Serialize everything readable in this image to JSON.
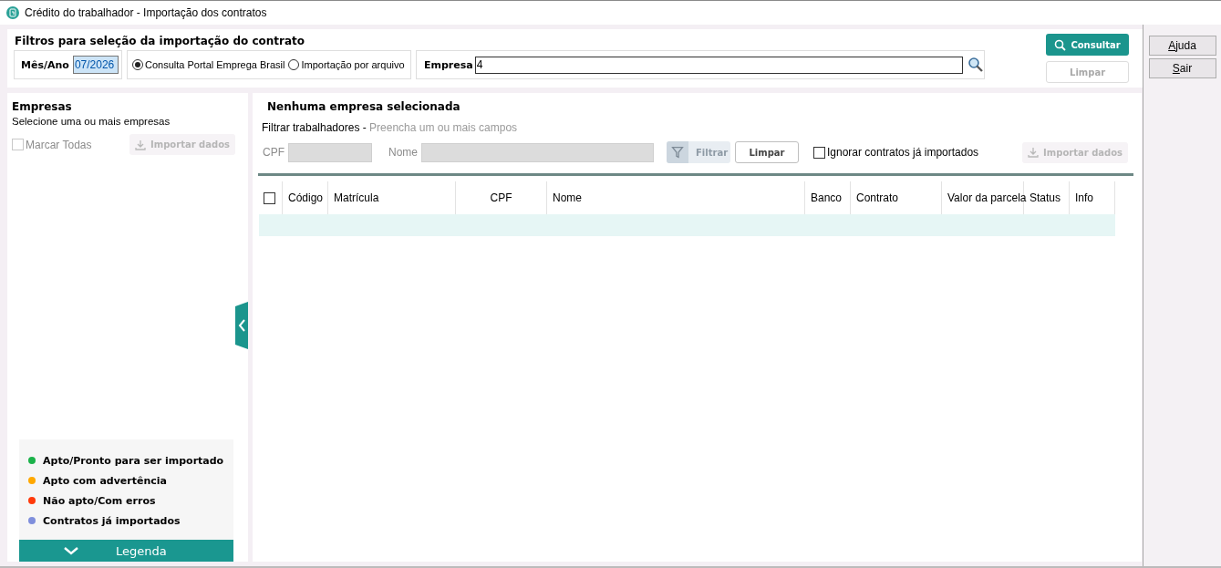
{
  "window": {
    "title": "Crédito do trabalhador - Importação dos contratos"
  },
  "filters": {
    "title": "Filtros para seleção da importação do contrato",
    "month_year": {
      "label": "Mês/Ano",
      "value": "07/2026"
    },
    "source_options": [
      {
        "label": "Consulta Portal Emprega Brasil",
        "selected": true
      },
      {
        "label": "Importação por arquivo",
        "selected": false
      }
    ],
    "company": {
      "label": "Empresa",
      "value": "4"
    },
    "buttons": [
      {
        "kind": "search",
        "label": "Consultar"
      },
      {
        "kind": "plain",
        "label": "Limpar",
        "disabled": true
      }
    ]
  },
  "side_buttons": [
    {
      "label": "Ajuda"
    },
    {
      "label": "Sair"
    }
  ],
  "companies_panel": {
    "title": "Empresas",
    "subtitle": "Selecione uma ou mais empresas",
    "select_all": {
      "label": "Marcar Todas",
      "checked": false,
      "disabled": true
    },
    "import_button": {
      "label": "Importar dados",
      "disabled": true
    },
    "legend": [
      {
        "label": "Apto/Pronto para ser importado",
        "color": "#1bb24a"
      },
      {
        "label": "Apto com advertência",
        "color": "#ffa800"
      },
      {
        "label": "Não apto/Com erros",
        "color": "#ff3a0a"
      },
      {
        "label": "Contratos já importados",
        "color": "#7f8fdc"
      }
    ],
    "legend_toggle": "Legenda"
  },
  "workers_panel": {
    "title": "Nenhuma empresa selecionada",
    "filter_label": "Filtrar trabalhadores - ",
    "filter_hint": "Preencha um ou mais campos",
    "cpf": {
      "label": "CPF",
      "disabled": true
    },
    "name": {
      "label": "Nome",
      "disabled": true
    },
    "filter_button": {
      "label": "Filtrar",
      "disabled": true
    },
    "clear_button": {
      "label": "Limpar",
      "disabled": false
    },
    "ignore_imported": {
      "label": "Ignorar contratos já importados",
      "checked": false
    },
    "import_button": {
      "label": "Importar dados",
      "disabled": true
    },
    "table": {
      "select_all_checked": false,
      "columns": [
        {
          "label": "Código"
        },
        {
          "label": "Matrícula"
        },
        {
          "label": "CPF"
        },
        {
          "label": "Nome"
        },
        {
          "label": "Banco"
        },
        {
          "label": "Contrato"
        },
        {
          "label": "Valor da parcela"
        },
        {
          "label": "Status"
        },
        {
          "label": "Info"
        }
      ]
    }
  }
}
